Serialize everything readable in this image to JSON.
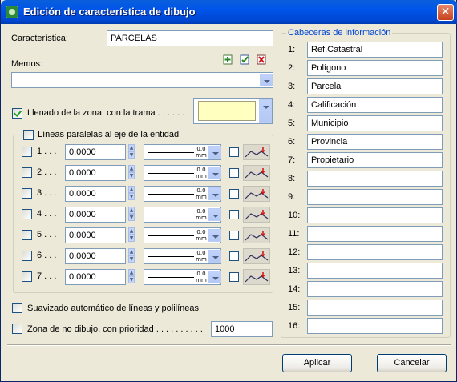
{
  "window": {
    "title": "Edición de característica de dibujo",
    "close_symbol": "✕"
  },
  "caracteristica": {
    "label": "Característica:",
    "value": "PARCELAS"
  },
  "memos": {
    "label": "Memos:",
    "value": "",
    "icons": [
      "add-memo-icon",
      "edit-memo-icon",
      "delete-memo-icon"
    ]
  },
  "llenado": {
    "label": "Llenado de la zona, con la trama . . . . . .",
    "checked": true,
    "color": "#ffffc0"
  },
  "lineas": {
    "label": "Líneas paralelas al eje de la entidad",
    "rows": [
      {
        "label": "1 . . .",
        "value": "0.0000",
        "width": "0.0",
        "unit": "mm"
      },
      {
        "label": "2 . . .",
        "value": "0.0000",
        "width": "0.0",
        "unit": "mm"
      },
      {
        "label": "3 . . .",
        "value": "0.0000",
        "width": "0.0",
        "unit": "mm"
      },
      {
        "label": "4 . . .",
        "value": "0.0000",
        "width": "0.0",
        "unit": "mm"
      },
      {
        "label": "5 . . .",
        "value": "0.0000",
        "width": "0.0",
        "unit": "mm"
      },
      {
        "label": "6 . . .",
        "value": "0.0000",
        "width": "0.0",
        "unit": "mm"
      },
      {
        "label": "7 . . .",
        "value": "0.0000",
        "width": "0.0",
        "unit": "mm"
      }
    ]
  },
  "suavizado": {
    "label": "Suavizado automático de líneas y polilíneas",
    "checked": false
  },
  "no_dibujo": {
    "label": "Zona de no dibujo, con prioridad . . . . . . . . . .",
    "checked": false,
    "value": "1000"
  },
  "cabeceras": {
    "title": "Cabeceras de información",
    "rows": [
      {
        "num": "1:",
        "value": "Ref.Catastral"
      },
      {
        "num": "2:",
        "value": "Polígono"
      },
      {
        "num": "3:",
        "value": "Parcela"
      },
      {
        "num": "4:",
        "value": "Calificación"
      },
      {
        "num": "5:",
        "value": "Municipio"
      },
      {
        "num": "6:",
        "value": "Provincia"
      },
      {
        "num": "7:",
        "value": "Propietario"
      },
      {
        "num": "8:",
        "value": ""
      },
      {
        "num": "9:",
        "value": ""
      },
      {
        "num": "10:",
        "value": ""
      },
      {
        "num": "11:",
        "value": ""
      },
      {
        "num": "12:",
        "value": ""
      },
      {
        "num": "13:",
        "value": ""
      },
      {
        "num": "14:",
        "value": ""
      },
      {
        "num": "15:",
        "value": ""
      },
      {
        "num": "16:",
        "value": ""
      }
    ]
  },
  "buttons": {
    "apply": "Aplicar",
    "cancel": "Cancelar"
  }
}
